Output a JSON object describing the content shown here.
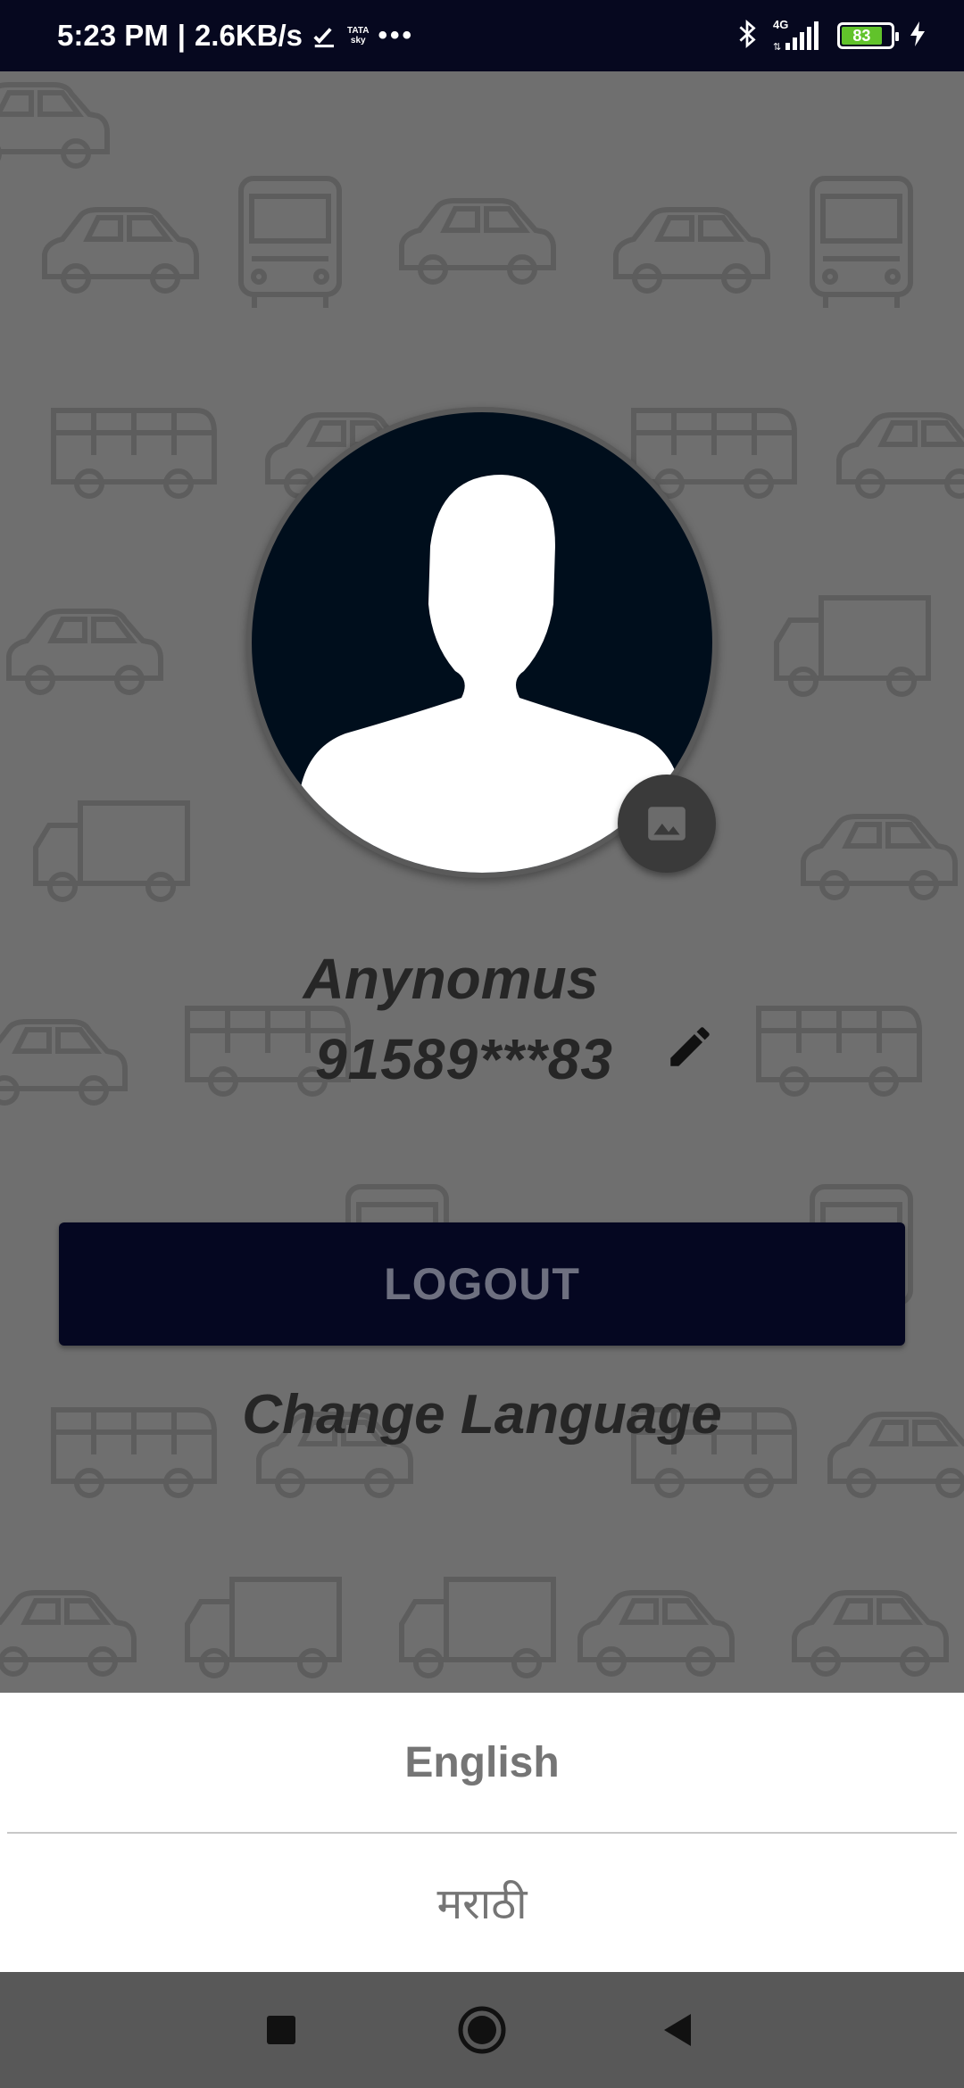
{
  "status_bar": {
    "time": "5:23 PM",
    "separator": "|",
    "speed": "2.6KB/s",
    "carrier_logo_top": "TATA",
    "carrier_logo_bottom": "sky",
    "more": "•••",
    "network": "4G",
    "battery": "83"
  },
  "profile": {
    "name": "Anynomus",
    "phone": "91589***83"
  },
  "actions": {
    "logout_label": "LOGOUT",
    "change_language_label": "Change Language"
  },
  "language_sheet": {
    "options": [
      {
        "label": "English"
      },
      {
        "label": "मराठी"
      }
    ]
  },
  "colors": {
    "status_bar_bg": "#06081f",
    "logout_bg": "#050721",
    "battery_fill": "#61c32b",
    "sheet_bg": "#ffffff"
  },
  "icons": {
    "status": [
      "check-icon",
      "bluetooth-icon",
      "signal-icon",
      "battery-icon",
      "charging-icon"
    ],
    "profile": [
      "avatar-placeholder-icon",
      "image-icon",
      "pencil-icon"
    ],
    "nav": [
      "recent-apps-icon",
      "home-icon",
      "back-icon"
    ]
  }
}
